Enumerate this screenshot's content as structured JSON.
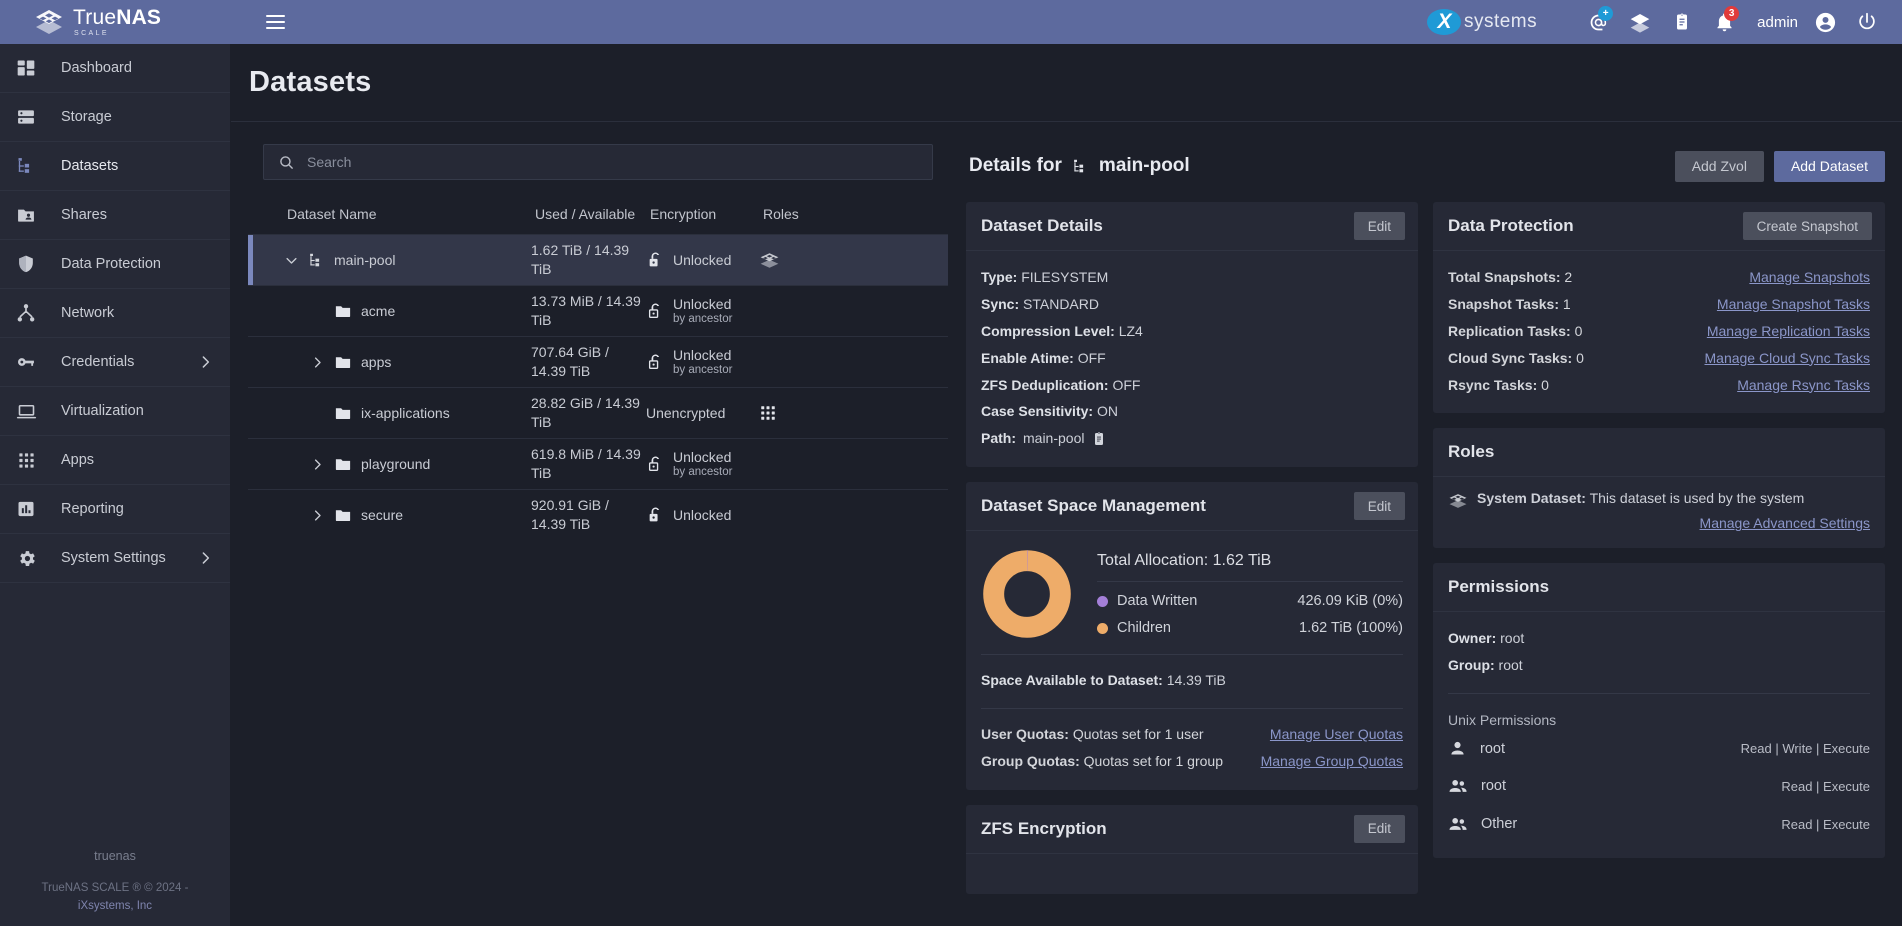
{
  "topbar": {
    "brand_name_light": "True",
    "brand_name_bold": "NAS",
    "brand_sub": "SCALE",
    "menu_icon": "hamburger-menu-icon",
    "ix_letter": "X",
    "ix_prefix": "i",
    "ix_word": "systems",
    "ix_tm": "™",
    "username": "admin",
    "icons": [
      {
        "name": "support-chat-icon",
        "badge": "+",
        "badge_color": "#1f9ad6"
      },
      {
        "name": "truecommand-icon",
        "badge": null
      },
      {
        "name": "jobs-clipboard-icon",
        "badge": null
      },
      {
        "name": "notifications-bell-icon",
        "badge": "3",
        "badge_color": "#e13b3b"
      }
    ],
    "account_icon": "account-circle-icon",
    "power_icon": "power-icon"
  },
  "sidebar": {
    "items": [
      {
        "label": "Dashboard",
        "icon": "dashboard-icon",
        "active": false,
        "submenu": false
      },
      {
        "label": "Storage",
        "icon": "storage-icon",
        "active": false,
        "submenu": false
      },
      {
        "label": "Datasets",
        "icon": "datasets-tree-icon",
        "active": true,
        "submenu": false
      },
      {
        "label": "Shares",
        "icon": "shares-folder-icon",
        "active": false,
        "submenu": false
      },
      {
        "label": "Data Protection",
        "icon": "shield-icon",
        "active": false,
        "submenu": false
      },
      {
        "label": "Network",
        "icon": "network-icon",
        "active": false,
        "submenu": false
      },
      {
        "label": "Credentials",
        "icon": "key-icon",
        "active": false,
        "submenu": true
      },
      {
        "label": "Virtualization",
        "icon": "laptop-icon",
        "active": false,
        "submenu": false
      },
      {
        "label": "Apps",
        "icon": "apps-grid-icon",
        "active": false,
        "submenu": false
      },
      {
        "label": "Reporting",
        "icon": "reporting-chart-icon",
        "active": false,
        "submenu": false
      },
      {
        "label": "System Settings",
        "icon": "gear-icon",
        "active": false,
        "submenu": true
      }
    ],
    "footer": {
      "hostname": "truenas",
      "copyright": "TrueNAS SCALE ® © 2024 -",
      "company": "iXsystems, Inc"
    }
  },
  "page": {
    "title": "Datasets"
  },
  "search": {
    "placeholder": "Search",
    "value": "",
    "icon": "search-icon"
  },
  "tree": {
    "columns": [
      "Dataset Name",
      "Used / Available",
      "Encryption",
      "Roles"
    ],
    "rows": [
      {
        "name": "main-pool",
        "indent": 0,
        "icon": "pool-tree-icon",
        "expander": "chevron-down-icon",
        "selected": true,
        "used": "1.62 TiB / 14.39 TiB",
        "used_line2": "",
        "encryption": "Unlocked",
        "encryption_sub": "",
        "enc_icon": "unlocked-lock-icon",
        "role_icon": "system-dataset-icon"
      },
      {
        "name": "acme",
        "indent": 1,
        "icon": "folder-icon",
        "expander": "",
        "selected": false,
        "used": "13.73 MiB / 14.39 TiB",
        "used_line2": "",
        "encryption": "Unlocked",
        "encryption_sub": "by ancestor",
        "enc_icon": "unlocked-by-ancestor-icon",
        "role_icon": ""
      },
      {
        "name": "apps",
        "indent": 1,
        "icon": "folder-icon",
        "expander": "chevron-right-icon",
        "selected": false,
        "used": "707.64 GiB /",
        "used_line2": "14.39 TiB",
        "encryption": "Unlocked",
        "encryption_sub": "by ancestor",
        "enc_icon": "unlocked-by-ancestor-icon",
        "role_icon": ""
      },
      {
        "name": "ix-applications",
        "indent": 1,
        "icon": "folder-icon",
        "expander": "",
        "selected": false,
        "used": "28.82 GiB / 14.39 TiB",
        "used_line2": "",
        "encryption": "Unencrypted",
        "encryption_sub": "",
        "enc_icon": "",
        "role_icon": "apps-grid-icon"
      },
      {
        "name": "playground",
        "indent": 1,
        "icon": "folder-icon",
        "expander": "chevron-right-icon",
        "selected": false,
        "used": "619.8 MiB / 14.39 TiB",
        "used_line2": "",
        "encryption": "Unlocked",
        "encryption_sub": "by ancestor",
        "enc_icon": "unlocked-by-ancestor-icon",
        "role_icon": ""
      },
      {
        "name": "secure",
        "indent": 1,
        "icon": "folder-icon",
        "expander": "chevron-right-icon",
        "selected": false,
        "used": "920.91 GiB /",
        "used_line2": "14.39 TiB",
        "encryption": "Unlocked",
        "encryption_sub": "",
        "enc_icon": "unlocked-lock-icon",
        "role_icon": ""
      }
    ]
  },
  "details": {
    "heading_prefix": "Details for",
    "dataset_name": "main-pool",
    "dataset_icon": "pool-tree-icon",
    "add_zvol": "Add Zvol",
    "add_dataset": "Add Dataset"
  },
  "dataset_details": {
    "title": "Dataset Details",
    "edit": "Edit",
    "fields": [
      {
        "label": "Type:",
        "value": "FILESYSTEM"
      },
      {
        "label": "Sync:",
        "value": "STANDARD"
      },
      {
        "label": "Compression Level:",
        "value": "LZ4"
      },
      {
        "label": "Enable Atime:",
        "value": "OFF"
      },
      {
        "label": "ZFS Deduplication:",
        "value": "OFF"
      },
      {
        "label": "Case Sensitivity:",
        "value": "ON"
      }
    ],
    "path_label": "Path:",
    "path_value": "main-pool",
    "copy_icon": "copy-clipboard-icon"
  },
  "space_management": {
    "title": "Dataset Space Management",
    "edit": "Edit",
    "total_allocation_label": "Total Allocation:",
    "total_allocation_value": "1.62 TiB",
    "space_available_label": "Space Available to Dataset:",
    "space_available_value": "14.39 TiB",
    "user_quotas_label": "User Quotas:",
    "user_quotas_value": "Quotas set for 1 user",
    "user_quotas_link": "Manage User Quotas",
    "group_quotas_label": "Group Quotas:",
    "group_quotas_value": "Quotas set for 1 group",
    "group_quotas_link": "Manage Group Quotas"
  },
  "chart_data": {
    "type": "pie",
    "title": "Dataset Space Management",
    "categories": [
      "Data Written",
      "Children"
    ],
    "values": [
      0,
      100
    ],
    "labels": [
      "426.09 KiB (0%)",
      "1.62 TiB (100%)"
    ],
    "colors": [
      "#a47fd8",
      "#eeac69"
    ],
    "total": "1.62 TiB",
    "legend_position": "right"
  },
  "zfs_encryption": {
    "title": "ZFS Encryption",
    "edit": "Edit"
  },
  "data_protection": {
    "title": "Data Protection",
    "create_snapshot": "Create Snapshot",
    "rows": [
      {
        "label": "Total Snapshots:",
        "value": "2",
        "link": "Manage Snapshots"
      },
      {
        "label": "Snapshot Tasks:",
        "value": "1",
        "link": "Manage Snapshot Tasks"
      },
      {
        "label": "Replication Tasks:",
        "value": "0",
        "link": "Manage Replication Tasks"
      },
      {
        "label": "Cloud Sync Tasks:",
        "value": "0",
        "link": "Manage Cloud Sync Tasks"
      },
      {
        "label": "Rsync Tasks:",
        "value": "0",
        "link": "Manage Rsync Tasks"
      }
    ]
  },
  "roles": {
    "title": "Roles",
    "system_dataset_label": "System Dataset:",
    "system_dataset_value": "This dataset is used by the system",
    "advanced_link": "Manage Advanced Settings",
    "icon": "system-dataset-icon"
  },
  "permissions": {
    "title": "Permissions",
    "owner_label": "Owner:",
    "owner_value": "root",
    "group_label": "Group:",
    "group_value": "root",
    "unix_label": "Unix Permissions",
    "entries": [
      {
        "name": "root",
        "icon": "person-icon",
        "perms": "Read | Write | Execute"
      },
      {
        "name": "root",
        "icon": "group-icon",
        "perms": "Read | Execute"
      },
      {
        "name": "Other",
        "icon": "group-icon",
        "perms": "Read | Execute"
      }
    ]
  },
  "colors": {
    "accent": "#5d6a9e",
    "chart_children": "#eeac69",
    "chart_data_written": "#a47fd8",
    "alert_red": "#e13b3b",
    "info_blue": "#1f9ad6"
  }
}
